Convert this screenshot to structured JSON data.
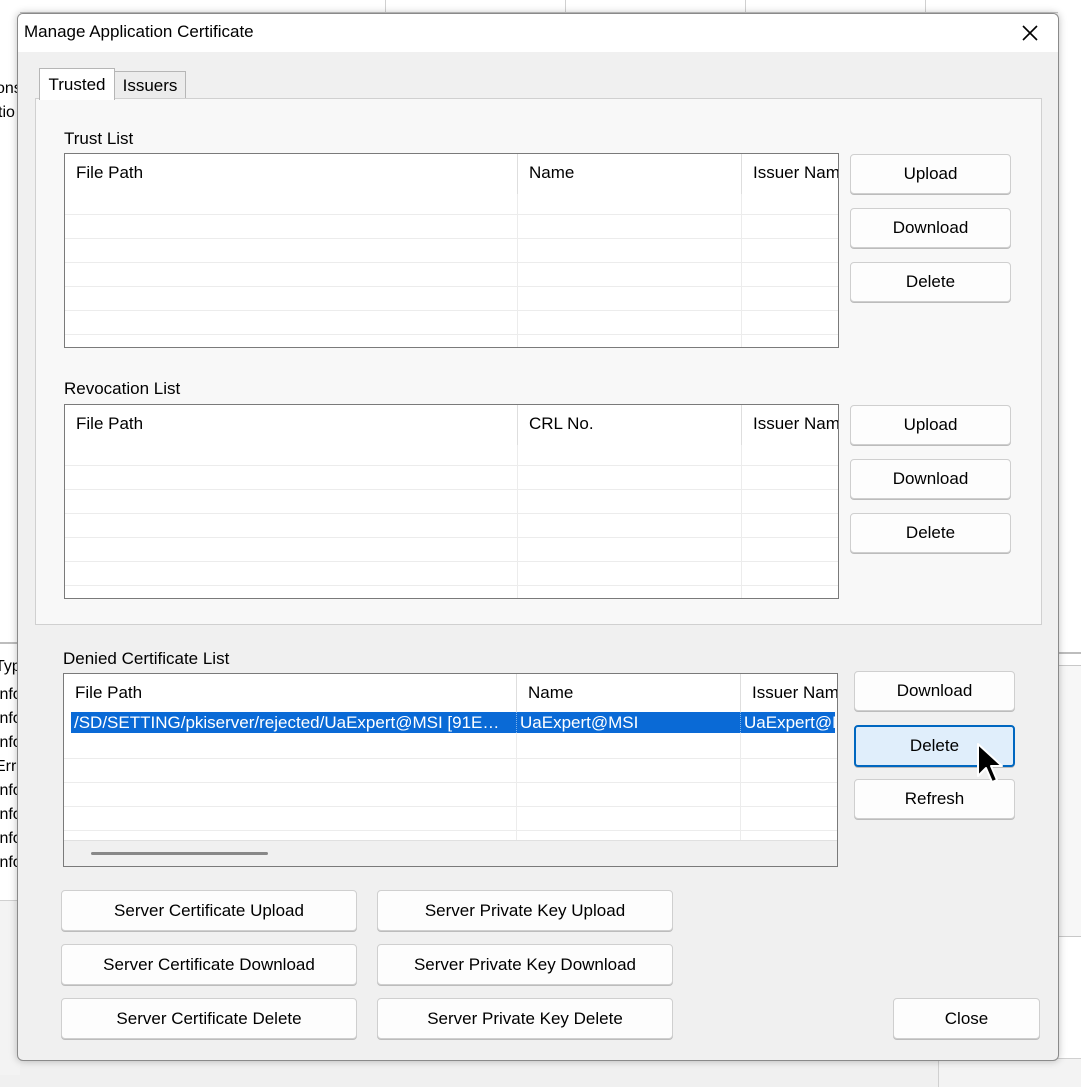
{
  "dialog": {
    "title": "Manage Application Certificate"
  },
  "tabs": [
    {
      "label": "Trusted",
      "active": true
    },
    {
      "label": "Issuers",
      "active": false
    }
  ],
  "background": {
    "left_upper": [
      "ons",
      "tio"
    ],
    "left_lower": [
      "Typ",
      "Info",
      "Info",
      "Info",
      "Erro",
      "Info",
      "Info",
      "Info",
      "Info"
    ]
  },
  "trust_list": {
    "label": "Trust List",
    "columns": [
      "File Path",
      "Name",
      "Issuer Name"
    ],
    "buttons": {
      "upload": "Upload",
      "download": "Download",
      "delete": "Delete"
    }
  },
  "revocation_list": {
    "label": "Revocation List",
    "columns": [
      "File Path",
      "CRL No.",
      "Issuer Name"
    ],
    "buttons": {
      "upload": "Upload",
      "download": "Download",
      "delete": "Delete"
    }
  },
  "denied_list": {
    "label": "Denied Certificate List",
    "columns": [
      "File Path",
      "Name",
      "Issuer Name"
    ],
    "rows": [
      {
        "file_path": "/SD/SETTING/pkiserver/rejected/UaExpert@MSI [91E…",
        "name": "UaExpert@MSI",
        "issuer": "UaExpert@M"
      }
    ],
    "buttons": {
      "download": "Download",
      "delete": "Delete",
      "refresh": "Refresh"
    }
  },
  "bottom_buttons": {
    "server_cert_upload": "Server Certificate Upload",
    "server_key_upload": "Server Private Key Upload",
    "server_cert_download": "Server Certificate Download",
    "server_key_download": "Server Private Key Download",
    "server_cert_delete": "Server Certificate Delete",
    "server_key_delete": "Server Private Key Delete",
    "close": "Close"
  },
  "colors": {
    "selection": "#0a6ad6",
    "focus_border": "#0067c0",
    "focus_fill": "#e0eefb"
  }
}
